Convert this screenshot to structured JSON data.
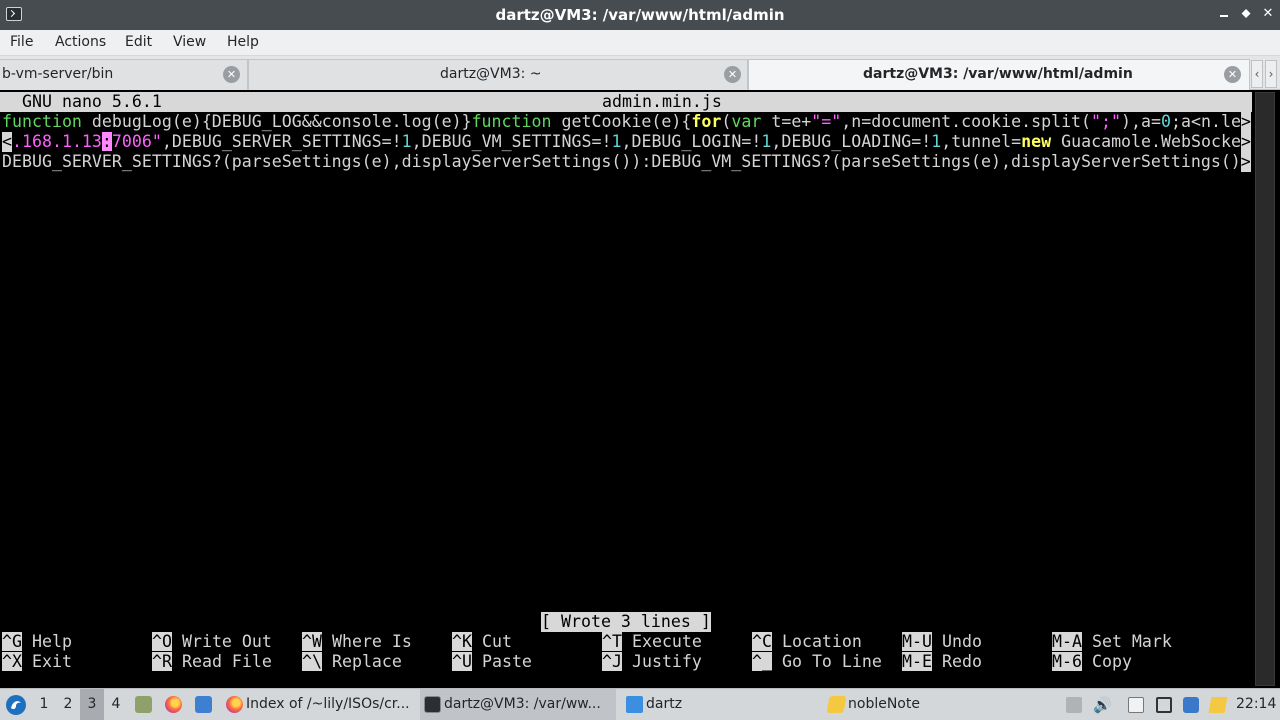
{
  "window": {
    "title": "dartz@VM3: /var/www/html/admin"
  },
  "menu": [
    "File",
    "Actions",
    "Edit",
    "View",
    "Help"
  ],
  "tabs": [
    {
      "label": "b-vm-server/bin"
    },
    {
      "label": "dartz@VM3: ~"
    },
    {
      "label": "dartz@VM3: /var/www/html/admin"
    }
  ],
  "nano": {
    "version": "GNU nano 5.6.1",
    "filename": "admin.min.js",
    "status": "[ Wrote 3 lines ]",
    "lines": [
      [
        {
          "t": "function",
          "c": "kw"
        },
        {
          "t": " debugLog(e){DEBUG_LOG&&console.log(e)}",
          "c": ""
        },
        {
          "t": "function",
          "c": "kw"
        },
        {
          "t": " getCookie(e){",
          "c": ""
        },
        {
          "t": "for",
          "c": "kwb"
        },
        {
          "t": "(",
          "c": ""
        },
        {
          "t": "var",
          "c": "kw"
        },
        {
          "t": " t=e+",
          "c": ""
        },
        {
          "t": "\"=\"",
          "c": "str"
        },
        {
          "t": ",n=document.cookie.split(",
          "c": ""
        },
        {
          "t": "\";\"",
          "c": "str"
        },
        {
          "t": "),a=",
          "c": ""
        },
        {
          "t": "0",
          "c": "num"
        },
        {
          "t": ";a<n.le",
          "c": ""
        },
        {
          "t": ">",
          "c": "trunc"
        }
      ],
      [
        {
          "t": "<",
          "c": "trunc"
        },
        {
          "t": ".168.1.13",
          "c": "str"
        },
        {
          "t": ":",
          "c": "cursor"
        },
        {
          "t": "7006\"",
          "c": "str"
        },
        {
          "t": ",DEBUG_SERVER_SETTINGS=!",
          "c": ""
        },
        {
          "t": "1",
          "c": "num"
        },
        {
          "t": ",DEBUG_VM_SETTINGS=!",
          "c": ""
        },
        {
          "t": "1",
          "c": "num"
        },
        {
          "t": ",DEBUG_LOGIN=!",
          "c": ""
        },
        {
          "t": "1",
          "c": "num"
        },
        {
          "t": ",DEBUG_LOADING=!",
          "c": ""
        },
        {
          "t": "1",
          "c": "num"
        },
        {
          "t": ",tunnel=",
          "c": ""
        },
        {
          "t": "new",
          "c": "kwb"
        },
        {
          "t": " Guacamole.WebSocke",
          "c": ""
        },
        {
          "t": ">",
          "c": "trunc"
        }
      ],
      [
        {
          "t": "DEBUG_SERVER_SETTINGS?(parseSettings(e),displayServerSettings()):DEBUG_VM_SETTINGS?(parseSettings(e),displayServerSettings()",
          "c": ""
        },
        {
          "t": ">",
          "c": "trunc"
        }
      ]
    ],
    "shortcuts": [
      {
        "key": "^G",
        "label": "Help"
      },
      {
        "key": "^X",
        "label": "Exit"
      },
      {
        "key": "^O",
        "label": "Write Out"
      },
      {
        "key": "^R",
        "label": "Read File"
      },
      {
        "key": "^W",
        "label": "Where Is"
      },
      {
        "key": "^\\",
        "label": "Replace"
      },
      {
        "key": "^K",
        "label": "Cut"
      },
      {
        "key": "^U",
        "label": "Paste"
      },
      {
        "key": "^T",
        "label": "Execute"
      },
      {
        "key": "^J",
        "label": "Justify"
      },
      {
        "key": "^C",
        "label": "Location"
      },
      {
        "key": "^_",
        "label": "Go To Line"
      },
      {
        "key": "M-U",
        "label": "Undo"
      },
      {
        "key": "M-E",
        "label": "Redo"
      },
      {
        "key": "M-A",
        "label": "Set Mark"
      },
      {
        "key": "M-6",
        "label": "Copy"
      }
    ]
  },
  "panel": {
    "desktops": [
      "1",
      "2",
      "3",
      "4"
    ],
    "active_desktop": "3",
    "tasks": [
      {
        "label": "Index of /~lily/ISOs/cr...",
        "icon": "firefox-icon"
      },
      {
        "label": "dartz@VM3: /var/ww...",
        "icon": "terminal-icon"
      },
      {
        "label": "dartz",
        "icon": "folder-icon"
      },
      {
        "label": "nobleNote",
        "icon": "note-icon"
      }
    ],
    "clock": "22:14"
  }
}
